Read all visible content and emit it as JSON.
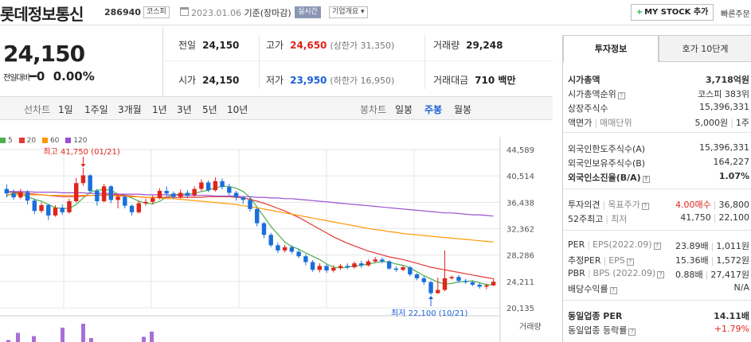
{
  "header": {
    "name": "롯데정보통신",
    "code": "286940",
    "market": "코스피",
    "date": "2023.01.06",
    "date_suffix": "기준(장마감)",
    "realtime": "실시간",
    "company": "기업개요",
    "mystock": "MY STOCK 추가",
    "quick": "빠른주문"
  },
  "price": {
    "current": "24,150",
    "change_label": "전일대비",
    "change_value": "0",
    "change_rate": "0.00%"
  },
  "quote": {
    "prev_label": "전일",
    "prev": "24,150",
    "high_label": "고가",
    "high": "24,650",
    "upper_limit": "(상한가 31,350)",
    "volume_label": "거래량",
    "volume": "29,248",
    "open_label": "시가",
    "open": "24,150",
    "low_label": "저가",
    "low": "23,950",
    "lower_limit": "(하한가 16,950)",
    "amount_label": "거래대금",
    "amount": "710 백만"
  },
  "period": {
    "line_label": "선차트",
    "line_items": [
      "1일",
      "1주일",
      "3개월",
      "1년",
      "3년",
      "5년",
      "10년"
    ],
    "candle_label": "봉차트",
    "candle_items": [
      "일봉",
      "주봉",
      "월봉"
    ],
    "active": "주봉"
  },
  "chart_data": {
    "type": "candlestick",
    "legend": [
      {
        "name": "5",
        "color": "#4caf50"
      },
      {
        "name": "20",
        "color": "#e53935"
      },
      {
        "name": "60",
        "color": "#ff9800"
      },
      {
        "name": "120",
        "color": "#9c4fd0"
      }
    ],
    "ylim": [
      20135,
      44589
    ],
    "yticks": [
      "44,589",
      "40,514",
      "36,438",
      "32,362",
      "28,286",
      "24,211",
      "20,135"
    ],
    "high_note": "최고 41,750 (01/21)",
    "low_note": "최저 22,100 (10/21)",
    "volume_label": "거래량",
    "colors": {
      "up": "#e0251b",
      "down": "#1a6fdc",
      "grid": "#e6e6e6"
    },
    "candles": [
      [
        38500,
        37800,
        39200,
        37200
      ],
      [
        37800,
        37200,
        38400,
        36800
      ],
      [
        37200,
        38000,
        38500,
        36900
      ],
      [
        38000,
        36700,
        38300,
        36100
      ],
      [
        36700,
        35100,
        37000,
        34600
      ],
      [
        35100,
        36000,
        36400,
        34800
      ],
      [
        36000,
        34400,
        36200,
        33700
      ],
      [
        34400,
        35600,
        36000,
        34200
      ],
      [
        35600,
        34900,
        36100,
        34500
      ],
      [
        34900,
        36600,
        37000,
        34700
      ],
      [
        36600,
        39400,
        40200,
        36400
      ],
      [
        39400,
        40600,
        41750,
        39000
      ],
      [
        40600,
        38200,
        40800,
        37900
      ],
      [
        38200,
        36600,
        38500,
        35900
      ],
      [
        36600,
        38900,
        39300,
        36400
      ],
      [
        38900,
        36800,
        39100,
        36300
      ],
      [
        36800,
        37300,
        37800,
        35500
      ],
      [
        37300,
        35900,
        37500,
        35500
      ],
      [
        35900,
        34900,
        36100,
        34400
      ],
      [
        34900,
        36300,
        36700,
        34700
      ],
      [
        36300,
        36500,
        37000,
        35900
      ],
      [
        36500,
        37100,
        37500,
        36100
      ],
      [
        37100,
        38200,
        38600,
        36900
      ],
      [
        38200,
        37800,
        38900,
        37300
      ],
      [
        37800,
        37300,
        38100,
        36900
      ],
      [
        37300,
        37900,
        38400,
        37000
      ],
      [
        37900,
        37500,
        38300,
        37100
      ],
      [
        37500,
        38500,
        38900,
        37300
      ],
      [
        38500,
        39500,
        40000,
        38200
      ],
      [
        39500,
        38300,
        39800,
        38000
      ],
      [
        38300,
        39700,
        40300,
        38100
      ],
      [
        39700,
        38800,
        40100,
        38400
      ],
      [
        38800,
        37900,
        39300,
        37500
      ],
      [
        37900,
        37200,
        38200,
        36700
      ],
      [
        37200,
        36800,
        37400,
        36200
      ],
      [
        36800,
        35400,
        37100,
        35000
      ],
      [
        35400,
        33200,
        35600,
        32700
      ],
      [
        33200,
        31400,
        33400,
        30900
      ],
      [
        31400,
        29800,
        31700,
        29500
      ],
      [
        29800,
        29000,
        30200,
        28600
      ],
      [
        29000,
        29500,
        29900,
        28700
      ],
      [
        29500,
        28800,
        29800,
        28500
      ],
      [
        28800,
        28100,
        29200,
        27800
      ],
      [
        28100,
        27200,
        28400,
        26700
      ],
      [
        27200,
        26000,
        27500,
        25700
      ],
      [
        26000,
        26600,
        27000,
        25600
      ],
      [
        26600,
        25900,
        26900,
        25500
      ],
      [
        25900,
        26300,
        26700,
        25600
      ],
      [
        26300,
        26600,
        26900,
        26000
      ],
      [
        26600,
        26400,
        27000,
        26100
      ],
      [
        26400,
        27000,
        27300,
        26200
      ],
      [
        27000,
        26700,
        27400,
        26300
      ],
      [
        26700,
        27300,
        27600,
        26500
      ],
      [
        27300,
        27600,
        28000,
        27100
      ],
      [
        27600,
        27300,
        27900,
        27000
      ],
      [
        27300,
        26200,
        27500,
        26000
      ],
      [
        26200,
        26000,
        26500,
        25700
      ],
      [
        26000,
        26400,
        26700,
        25800
      ],
      [
        26400,
        25300,
        26600,
        25000
      ],
      [
        25300,
        24700,
        25500,
        24400
      ],
      [
        24700,
        24100,
        25000,
        23700
      ],
      [
        24100,
        22400,
        24300,
        22100
      ],
      [
        22400,
        22900,
        24800,
        22300
      ],
      [
        22900,
        24700,
        29000,
        22700
      ],
      [
        24700,
        24900,
        25100,
        24500
      ],
      [
        24900,
        24300,
        25200,
        24000
      ],
      [
        24300,
        24100,
        24600,
        23800
      ],
      [
        24100,
        23700,
        24300,
        23500
      ],
      [
        23700,
        23400,
        24000,
        23100
      ],
      [
        23400,
        23600,
        23900,
        23000
      ],
      [
        23600,
        24150,
        24650,
        23500
      ]
    ],
    "ma": {
      "5": [
        37400,
        37900,
        37700,
        37300,
        36900,
        36600,
        36100,
        35600,
        35500,
        35500,
        36100,
        37100,
        38000,
        38300,
        38400,
        38300,
        37700,
        37500,
        37100,
        36600,
        36300,
        36200,
        36600,
        37200,
        37600,
        37700,
        37700,
        37800,
        38100,
        38300,
        38700,
        38900,
        38900,
        38600,
        38100,
        37200,
        35700,
        34200,
        32700,
        31500,
        30300,
        29600,
        29200,
        28600,
        28100,
        27600,
        26900,
        26400,
        26300,
        26400,
        26600,
        26700,
        26900,
        27100,
        27300,
        27200,
        26900,
        26700,
        26300,
        25700,
        25100,
        24600,
        24100,
        23800,
        23900,
        24100,
        24200,
        24300,
        24000,
        23700,
        23700
      ],
      "20": [
        38000,
        38000,
        37900,
        37800,
        37700,
        37600,
        37500,
        37400,
        37300,
        37300,
        37300,
        37400,
        37500,
        37500,
        37600,
        37600,
        37600,
        37500,
        37400,
        37300,
        37200,
        37200,
        37200,
        37200,
        37200,
        37200,
        37200,
        37200,
        37200,
        37300,
        37300,
        37300,
        37300,
        37200,
        37100,
        36900,
        36600,
        36300,
        35900,
        35500,
        35100,
        34600,
        34100,
        33500,
        32900,
        32300,
        31700,
        31100,
        30600,
        30100,
        29700,
        29300,
        28900,
        28600,
        28300,
        28000,
        27800,
        27600,
        27300,
        27000,
        26700,
        26400,
        26200,
        26000,
        25800,
        25600,
        25400,
        25200,
        25000,
        24800,
        24650
      ],
      "60": [
        37600,
        37600,
        37600,
        37600,
        37600,
        37600,
        37500,
        37500,
        37500,
        37500,
        37500,
        37500,
        37500,
        37500,
        37500,
        37500,
        37400,
        37400,
        37300,
        37300,
        37200,
        37200,
        37100,
        37000,
        37000,
        36900,
        36800,
        36700,
        36600,
        36500,
        36400,
        36300,
        36200,
        36100,
        35900,
        35800,
        35600,
        35400,
        35200,
        35000,
        34800,
        34600,
        34400,
        34200,
        34000,
        33800,
        33600,
        33400,
        33200,
        33000,
        32800,
        32600,
        32400,
        32200,
        32100,
        31900,
        31800,
        31600,
        31500,
        31400,
        31300,
        31200,
        31100,
        31000,
        30900,
        30800,
        30700,
        30600,
        30500,
        30400,
        30300
      ],
      "120": [
        38100,
        38100,
        38100,
        38100,
        38000,
        38000,
        38000,
        38000,
        37900,
        37900,
        37900,
        37900,
        37800,
        37800,
        37800,
        37800,
        37700,
        37700,
        37700,
        37700,
        37600,
        37600,
        37600,
        37600,
        37600,
        37500,
        37500,
        37500,
        37500,
        37500,
        37400,
        37400,
        37400,
        37400,
        37300,
        37300,
        37200,
        37200,
        37100,
        37100,
        37000,
        37000,
        36900,
        36800,
        36700,
        36600,
        36500,
        36400,
        36300,
        36200,
        36100,
        36000,
        35900,
        35800,
        35700,
        35600,
        35500,
        35400,
        35300,
        35200,
        35100,
        35000,
        34900,
        34800,
        34800,
        34700,
        34600,
        34500,
        34500,
        34400,
        34300
      ]
    },
    "volume": [
      3,
      14,
      9,
      22,
      28,
      6,
      8,
      16
    ]
  },
  "invest": {
    "tab_on": "투자정보",
    "tab_off": "호가 10단계",
    "rows": [
      {
        "k": "시가총액",
        "v": "3,718억원",
        "bold": true
      },
      {
        "k": "시가총액순위",
        "v": "코스피 383위"
      },
      {
        "k": "상장주식수",
        "v": "15,396,331"
      },
      {
        "k": "액면가",
        "k2": "매매단위",
        "v": "5,000원",
        "v2": "1주"
      },
      {
        "k": "외국인한도주식수(A)",
        "v": "15,396,331"
      },
      {
        "k": "외국인보유주식수(B)",
        "v": "164,227"
      },
      {
        "k": "외국인소진율(B/A)",
        "v": "1.07%",
        "bold": true
      },
      {
        "k": "투자의견",
        "k2": "목표주가",
        "v": "4.00매수",
        "v2": "36,800"
      },
      {
        "k": "52주최고",
        "k2": "최저",
        "v": "41,750",
        "v2": "22,100"
      },
      {
        "k": "PER",
        "k2": "EPS(2022.09)",
        "v": "23.89배",
        "v2": "1,011원"
      },
      {
        "k": "추정PER",
        "k2": "EPS",
        "v": "15.36배",
        "v2": "1,572원"
      },
      {
        "k": "PBR",
        "k2": "BPS (2022.09)",
        "v": "0.88배",
        "v2": "27,417원"
      },
      {
        "k": "배당수익률",
        "v": "N/A"
      },
      {
        "k": "동일업종 PER",
        "v": "14.11배",
        "bold": true
      },
      {
        "k": "동일업종 등락률",
        "v": "+1.79%"
      }
    ]
  }
}
